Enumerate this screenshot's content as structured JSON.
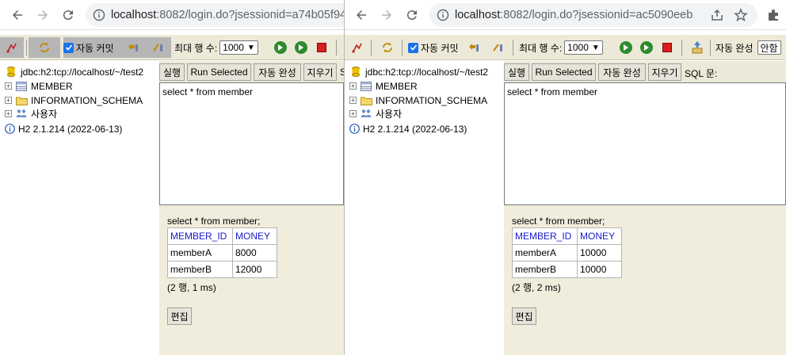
{
  "browser_left": {
    "url_host": "localhost",
    "url_rest": ":8082/login.do?jsessionid=a74b05f94"
  },
  "browser_right": {
    "url_host": "localhost",
    "url_rest": ":8082/login.do?jsessionid=ac5090eeb..."
  },
  "toolbar": {
    "auto_commit": "자동 커밋",
    "max_rows_label": "최대 행 수:",
    "max_rows_value": "1000",
    "auto_complete": "자동 완성",
    "auto_complete_value": "안함"
  },
  "tree": {
    "connection": "jdbc:h2:tcp://localhost/~/test2",
    "items": [
      "MEMBER",
      "INFORMATION_SCHEMA",
      "사용자"
    ],
    "version": "H2 2.1.214 (2022-06-13)"
  },
  "sql": {
    "run": "실행",
    "run_selected": "Run Selected",
    "auto_complete": "자동 완성",
    "clear": "지우기",
    "label": "SQL 문:",
    "label_cut": "S",
    "query": "select * from member"
  },
  "result_left": {
    "query": "select * from member;",
    "columns": [
      "MEMBER_ID",
      "MONEY"
    ],
    "rows": [
      [
        "memberA",
        "8000"
      ],
      [
        "memberB",
        "12000"
      ]
    ],
    "count": "(2 행, 1 ms)",
    "edit": "편집"
  },
  "result_right": {
    "query": "select * from member;",
    "columns": [
      "MEMBER_ID",
      "MONEY"
    ],
    "rows": [
      [
        "memberA",
        "10000"
      ],
      [
        "memberB",
        "10000"
      ]
    ],
    "count": "(2 행, 2 ms)",
    "edit": "편집"
  },
  "colors": {
    "h2_bg": "#ece9d8",
    "result_bg": "#f0eddd",
    "header_link": "#1a1acc",
    "checkbox": "#1a73e8"
  }
}
